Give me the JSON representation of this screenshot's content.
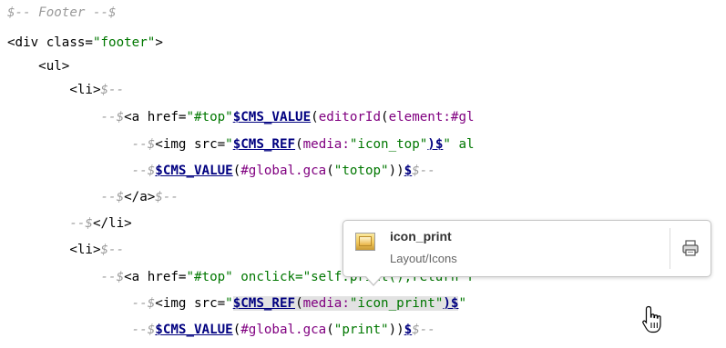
{
  "editor": {
    "lines": [
      {
        "tokens": [
          {
            "t": "$-- Footer --$",
            "c": "cm"
          }
        ]
      },
      {
        "tokens": [
          {
            "t": "<div class=",
            "c": "tag"
          },
          {
            "t": "\"footer\"",
            "c": "str"
          },
          {
            "t": ">",
            "c": "tag"
          }
        ]
      },
      {
        "tokens": [
          {
            "t": "    <ul>",
            "c": "tag"
          }
        ]
      },
      {
        "tokens": [
          {
            "t": "        <li>",
            "c": "tag"
          },
          {
            "t": "$--",
            "c": "cm"
          }
        ]
      },
      {
        "tokens": [
          {
            "t": "            --$",
            "c": "cm"
          },
          {
            "t": "<a href=",
            "c": "tag"
          },
          {
            "t": "\"#top\"",
            "c": "str"
          },
          {
            "t": "$CMS_VALUE",
            "c": "cms"
          },
          {
            "t": "(",
            "c": "tag"
          },
          {
            "t": "editorId",
            "c": "fn"
          },
          {
            "t": "(",
            "c": "tag"
          },
          {
            "t": "element:#gl",
            "c": "fn"
          }
        ]
      },
      {
        "tokens": [
          {
            "t": "                --$",
            "c": "cm"
          },
          {
            "t": "<img src=",
            "c": "tag"
          },
          {
            "t": "\"",
            "c": "str"
          },
          {
            "t": "$CMS_REF",
            "c": "cms"
          },
          {
            "t": "(",
            "c": "tag"
          },
          {
            "t": "media:",
            "c": "fn"
          },
          {
            "t": "\"icon_top\"",
            "c": "str"
          },
          {
            "t": ")$",
            "c": "cms"
          },
          {
            "t": "\" al",
            "c": "str"
          }
        ]
      },
      {
        "tokens": [
          {
            "t": "                --$",
            "c": "cm"
          },
          {
            "t": "$CMS_VALUE",
            "c": "cms"
          },
          {
            "t": "(",
            "c": "tag"
          },
          {
            "t": "#global.gca",
            "c": "fn"
          },
          {
            "t": "(",
            "c": "tag"
          },
          {
            "t": "\"totop\"",
            "c": "str"
          },
          {
            "t": "))",
            "c": "tag"
          },
          {
            "t": "$",
            "c": "cms"
          },
          {
            "t": "$--",
            "c": "cm"
          }
        ]
      },
      {
        "tokens": [
          {
            "t": "            --$",
            "c": "cm"
          },
          {
            "t": "</a>",
            "c": "tag"
          },
          {
            "t": "$--",
            "c": "cm"
          }
        ]
      },
      {
        "tokens": [
          {
            "t": "        --$",
            "c": "cm"
          },
          {
            "t": "</li>",
            "c": "tag"
          }
        ]
      },
      {
        "tokens": [
          {
            "t": "        <li>",
            "c": "tag"
          },
          {
            "t": "$--",
            "c": "cm"
          }
        ]
      },
      {
        "tokens": [
          {
            "t": "            --$",
            "c": "cm"
          },
          {
            "t": "<a href=",
            "c": "tag"
          },
          {
            "t": "\"#top\"",
            "c": "str"
          },
          {
            "t": " onclick=\"self.print();return f",
            "c": "str"
          }
        ]
      },
      {
        "tokens": [
          {
            "t": "                --$",
            "c": "cm"
          },
          {
            "t": "<img src=",
            "c": "tag"
          },
          {
            "t": "\"",
            "c": "str"
          },
          {
            "t": "$CMS_REF",
            "c": "cms sel"
          },
          {
            "t": "(",
            "c": "tag sel"
          },
          {
            "t": "media:",
            "c": "fn sel"
          },
          {
            "t": "\"icon_print\"",
            "c": "str sel"
          },
          {
            "t": ")$",
            "c": "cms sel"
          },
          {
            "t": "\"",
            "c": "str"
          }
        ]
      },
      {
        "tokens": [
          {
            "t": "                --$",
            "c": "cm"
          },
          {
            "t": "$CMS_VALUE",
            "c": "cms"
          },
          {
            "t": "(",
            "c": "tag"
          },
          {
            "t": "#global.gca",
            "c": "fn"
          },
          {
            "t": "(",
            "c": "tag"
          },
          {
            "t": "\"print\"",
            "c": "str"
          },
          {
            "t": "))",
            "c": "tag"
          },
          {
            "t": "$",
            "c": "cms"
          },
          {
            "t": "$--",
            "c": "cm"
          }
        ]
      }
    ]
  },
  "popup": {
    "title": "icon_print",
    "subtitle": "Layout/Icons",
    "thumbnail_icon": "image-thumbnail-icon",
    "action_icon": "printer-icon"
  }
}
